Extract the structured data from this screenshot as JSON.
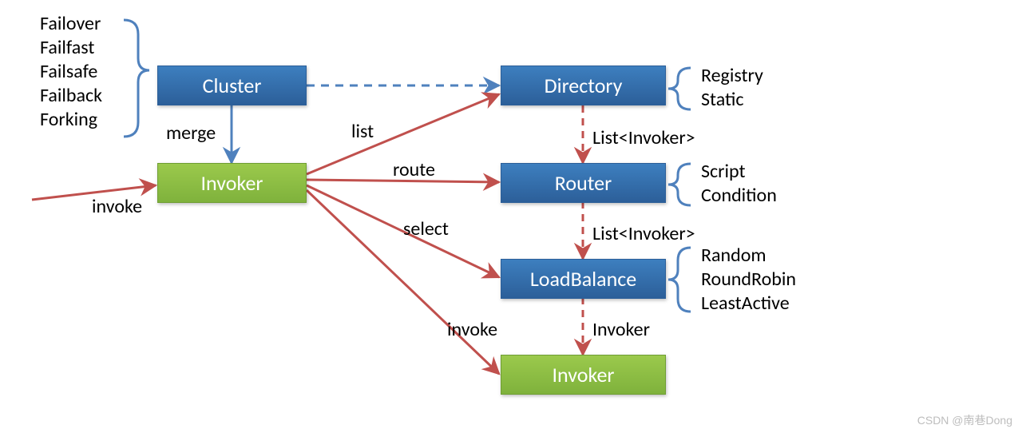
{
  "boxes": {
    "cluster": "Cluster",
    "invoker1": "Invoker",
    "directory": "Directory",
    "router": "Router",
    "loadbalance": "LoadBalance",
    "invoker2": "Invoker"
  },
  "labels": {
    "merge": "merge",
    "invoke_left": "invoke",
    "list": "list",
    "route": "route",
    "select": "select",
    "invoke_bottom": "invoke",
    "list_invoker_1": "List<Invoker>",
    "list_invoker_2": "List<Invoker>",
    "invoker_right": "Invoker"
  },
  "lists": {
    "cluster": [
      "Failover",
      "Failfast",
      "Failsafe",
      "Failback",
      "Forking"
    ],
    "directory": [
      "Registry",
      "Static"
    ],
    "router": [
      "Script",
      "Condition"
    ],
    "loadbalance": [
      "Random",
      "RoundRobin",
      "LeastActive"
    ]
  },
  "watermark": "CSDN @南巷Dong",
  "colors": {
    "blue": "#2c5f99",
    "green": "#8bc34a",
    "red": "#c0504d",
    "brace": "#4f81bd"
  }
}
